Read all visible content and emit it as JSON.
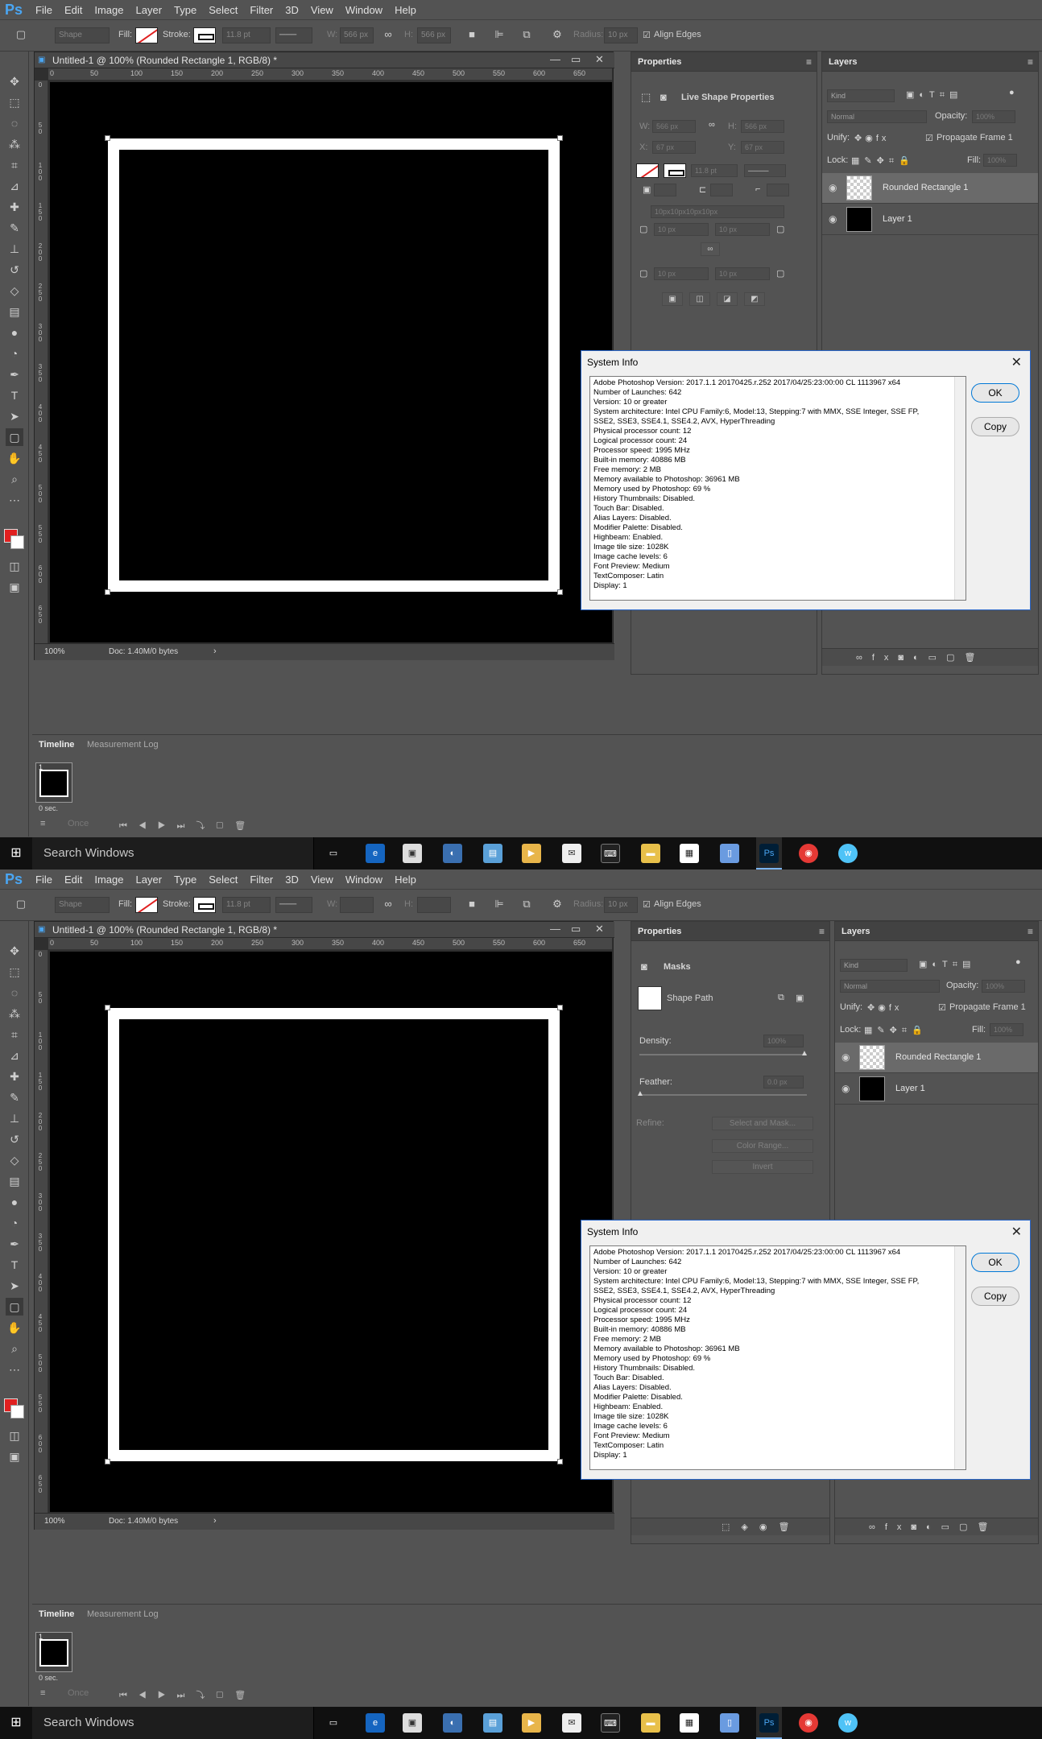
{
  "menu": {
    "logo": "Ps",
    "items": [
      "File",
      "Edit",
      "Image",
      "Layer",
      "Type",
      "Select",
      "Filter",
      "3D",
      "View",
      "Window",
      "Help"
    ]
  },
  "options": {
    "mode": "Shape",
    "fill_label": "Fill:",
    "stroke_label": "Stroke:",
    "stroke_width": "11.8 pt",
    "w_label": "W:",
    "h_label": "H:",
    "radius_label": "Radius:",
    "radius_value": "10 px",
    "align_edges": "Align Edges"
  },
  "document": {
    "tab_title": "Untitled-1 @ 100% (Rounded Rectangle 1, RGB/8) *",
    "zoom": "100%",
    "doc_info": "Doc: 1.40M/0 bytes",
    "ruler_marks": [
      "0",
      "50",
      "100",
      "150",
      "200",
      "250",
      "300",
      "350",
      "400",
      "450",
      "500",
      "550",
      "600",
      "650"
    ],
    "v_ruler_marks": [
      "0",
      "5\n0",
      "1\n0\n0",
      "1\n5\n0",
      "2\n0\n0",
      "2\n5\n0",
      "3\n0\n0",
      "3\n5\n0",
      "4\n0\n0",
      "4\n5\n0",
      "5\n0\n0",
      "5\n5\n0",
      "6\n0\n0",
      "6\n5\n0"
    ]
  },
  "properties_a": {
    "title": "Properties",
    "section": "Live Shape Properties",
    "w_label": "W:",
    "w_value": "566 px",
    "h_label": "H:",
    "h_value": "566 px",
    "x_label": "X:",
    "x_value": "67 px",
    "y_label": "Y:",
    "y_value": "67 px",
    "stroke_value": "11.8 pt",
    "radius_all": "10px10px10px10px",
    "radius_tl": "10 px",
    "radius_tr": "10 px",
    "radius_bl": "10 px",
    "radius_br": "10 px"
  },
  "properties_b": {
    "title": "Properties",
    "section": "Masks",
    "shape_path": "Shape Path",
    "density_label": "Density:",
    "density_value": "100%",
    "feather_label": "Feather:",
    "feather_value": "0.0 px",
    "refine_label": "Refine:",
    "select_mask": "Select and Mask...",
    "color_range": "Color Range...",
    "invert": "Invert"
  },
  "layers": {
    "title": "Layers",
    "kind": "Kind",
    "blend": "Normal",
    "opacity_label": "Opacity:",
    "opacity_value": "100%",
    "unify_label": "Unify:",
    "propagate": "Propagate Frame 1",
    "lock_label": "Lock:",
    "fill_label": "Fill:",
    "fill_value": "100%",
    "items": [
      {
        "name": "Rounded Rectangle 1"
      },
      {
        "name": "Layer 1"
      }
    ]
  },
  "sysinfo": {
    "title": "System Info",
    "ok": "OK",
    "copy": "Copy",
    "lines": [
      "Adobe Photoshop Version: 2017.1.1 20170425.r.252 2017/04/25:23:00:00 CL 1113967  x64",
      "Number of Launches: 642",
      "Version: 10 or greater",
      "System architecture: Intel CPU Family:6, Model:13, Stepping:7 with MMX, SSE Integer, SSE FP,",
      "SSE2, SSE3, SSE4.1, SSE4.2, AVX, HyperThreading",
      "Physical processor count: 12",
      "Logical processor count: 24",
      "Processor speed: 1995 MHz",
      "Built-in memory: 40886 MB",
      "Free memory: 2 MB",
      "Memory available to Photoshop: 36961 MB",
      "Memory used by Photoshop: 69 %",
      "History Thumbnails: Disabled.",
      "Touch Bar: Disabled.",
      "Alias Layers: Disabled.",
      "Modifier Palette: Disabled.",
      "Highbeam: Enabled.",
      "Image tile size: 1028K",
      "Image cache levels: 6",
      "Font Preview: Medium",
      "TextComposer: Latin",
      "Display: 1"
    ]
  },
  "timeline": {
    "tab": "Timeline",
    "tab2": "Measurement Log",
    "frame_num": "1",
    "frame_time": "0 sec.",
    "loop": "Once"
  },
  "taskbar": {
    "search": "Search Windows"
  },
  "colors": {
    "accent": "#2a66c8",
    "foreground_swatch": "#e02020",
    "ps_blue": "#4aa6f3"
  }
}
